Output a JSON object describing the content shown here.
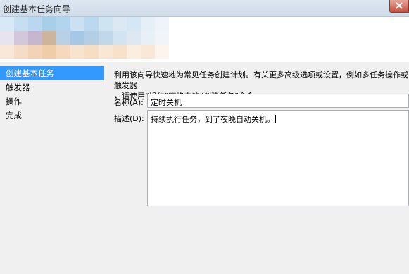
{
  "window": {
    "title": "创建基本任务向导"
  },
  "nav": {
    "items": [
      {
        "label": "创建基本任务"
      },
      {
        "label": "触发器"
      },
      {
        "label": "操作"
      },
      {
        "label": "完成"
      }
    ]
  },
  "content": {
    "description_line1": "利用该向导快速地为常见任务创建计划。有关更多高级选项或设置，例如多任务操作或触发器",
    "description_line2": "，请使用“操作”窗格中的“创建任务”命令。",
    "name_label": "名称(A):",
    "name_value": "定时关机",
    "desc_label": "描述(D):",
    "desc_value": "持续执行任务，到了夜晚自动关机。"
  },
  "colors": {
    "selection": "#3399ff",
    "close_button": "#c7503e"
  },
  "icons": {
    "close": "close-icon"
  }
}
